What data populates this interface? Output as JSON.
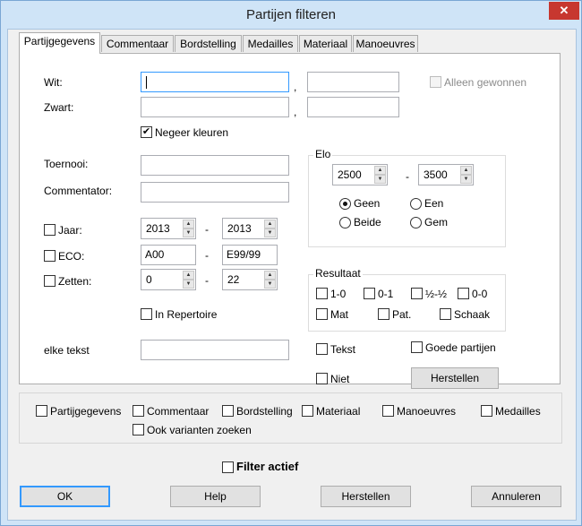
{
  "window": {
    "title": "Partijen filteren",
    "close_icon": "close-icon"
  },
  "tabs": [
    "Partijgegevens",
    "Commentaar",
    "Bordstelling",
    "Medailles",
    "Materiaal",
    "Manoeuvres"
  ],
  "fields": {
    "wit_label": "Wit:",
    "zwart_label": "Zwart:",
    "separator": ",",
    "wit_value": "",
    "wit_value2": "",
    "zwart_value": "",
    "zwart_value2": "",
    "alleen_gewonnen": "Alleen gewonnen",
    "negeer_kleuren": "Negeer kleuren",
    "toernooi_label": "Toernooi:",
    "toernooi_value": "",
    "commentator_label": "Commentator:",
    "commentator_value": "",
    "jaar_label": "Jaar:",
    "jaar_from": "2013",
    "jaar_to": "2013",
    "eco_label": "ECO:",
    "eco_from": "A00",
    "eco_to": "E99/99",
    "zetten_label": "Zetten:",
    "zetten_from": "0",
    "zetten_to": "22",
    "dash": "-",
    "in_repertoire": "In Repertoire",
    "elke_tekst_label": "elke tekst",
    "elke_tekst_value": ""
  },
  "elo": {
    "title": "Elo",
    "from": "2500",
    "to": "3500",
    "dash": "-",
    "options": [
      "Geen",
      "Een",
      "Beide",
      "Gem"
    ],
    "selected": "Geen"
  },
  "resultaat": {
    "title": "Resultaat",
    "options_row1": [
      "1-0",
      "0-1",
      "½-½",
      "0-0"
    ],
    "options_row2": [
      "Mat",
      "Pat.",
      "Schaak"
    ]
  },
  "extra": {
    "tekst": "Tekst",
    "goede_partijen": "Goede partijen",
    "niet": "Niet",
    "herstellen": "Herstellen"
  },
  "search_in": [
    "Partijgegevens",
    "Commentaar",
    "Bordstelling",
    "Materiaal",
    "Manoeuvres",
    "Medailles"
  ],
  "ook_varianten": "Ook varianten zoeken",
  "filter_actief": "Filter actief",
  "buttons": {
    "ok": "OK",
    "help": "Help",
    "herstellen": "Herstellen",
    "annuleren": "Annuleren"
  }
}
